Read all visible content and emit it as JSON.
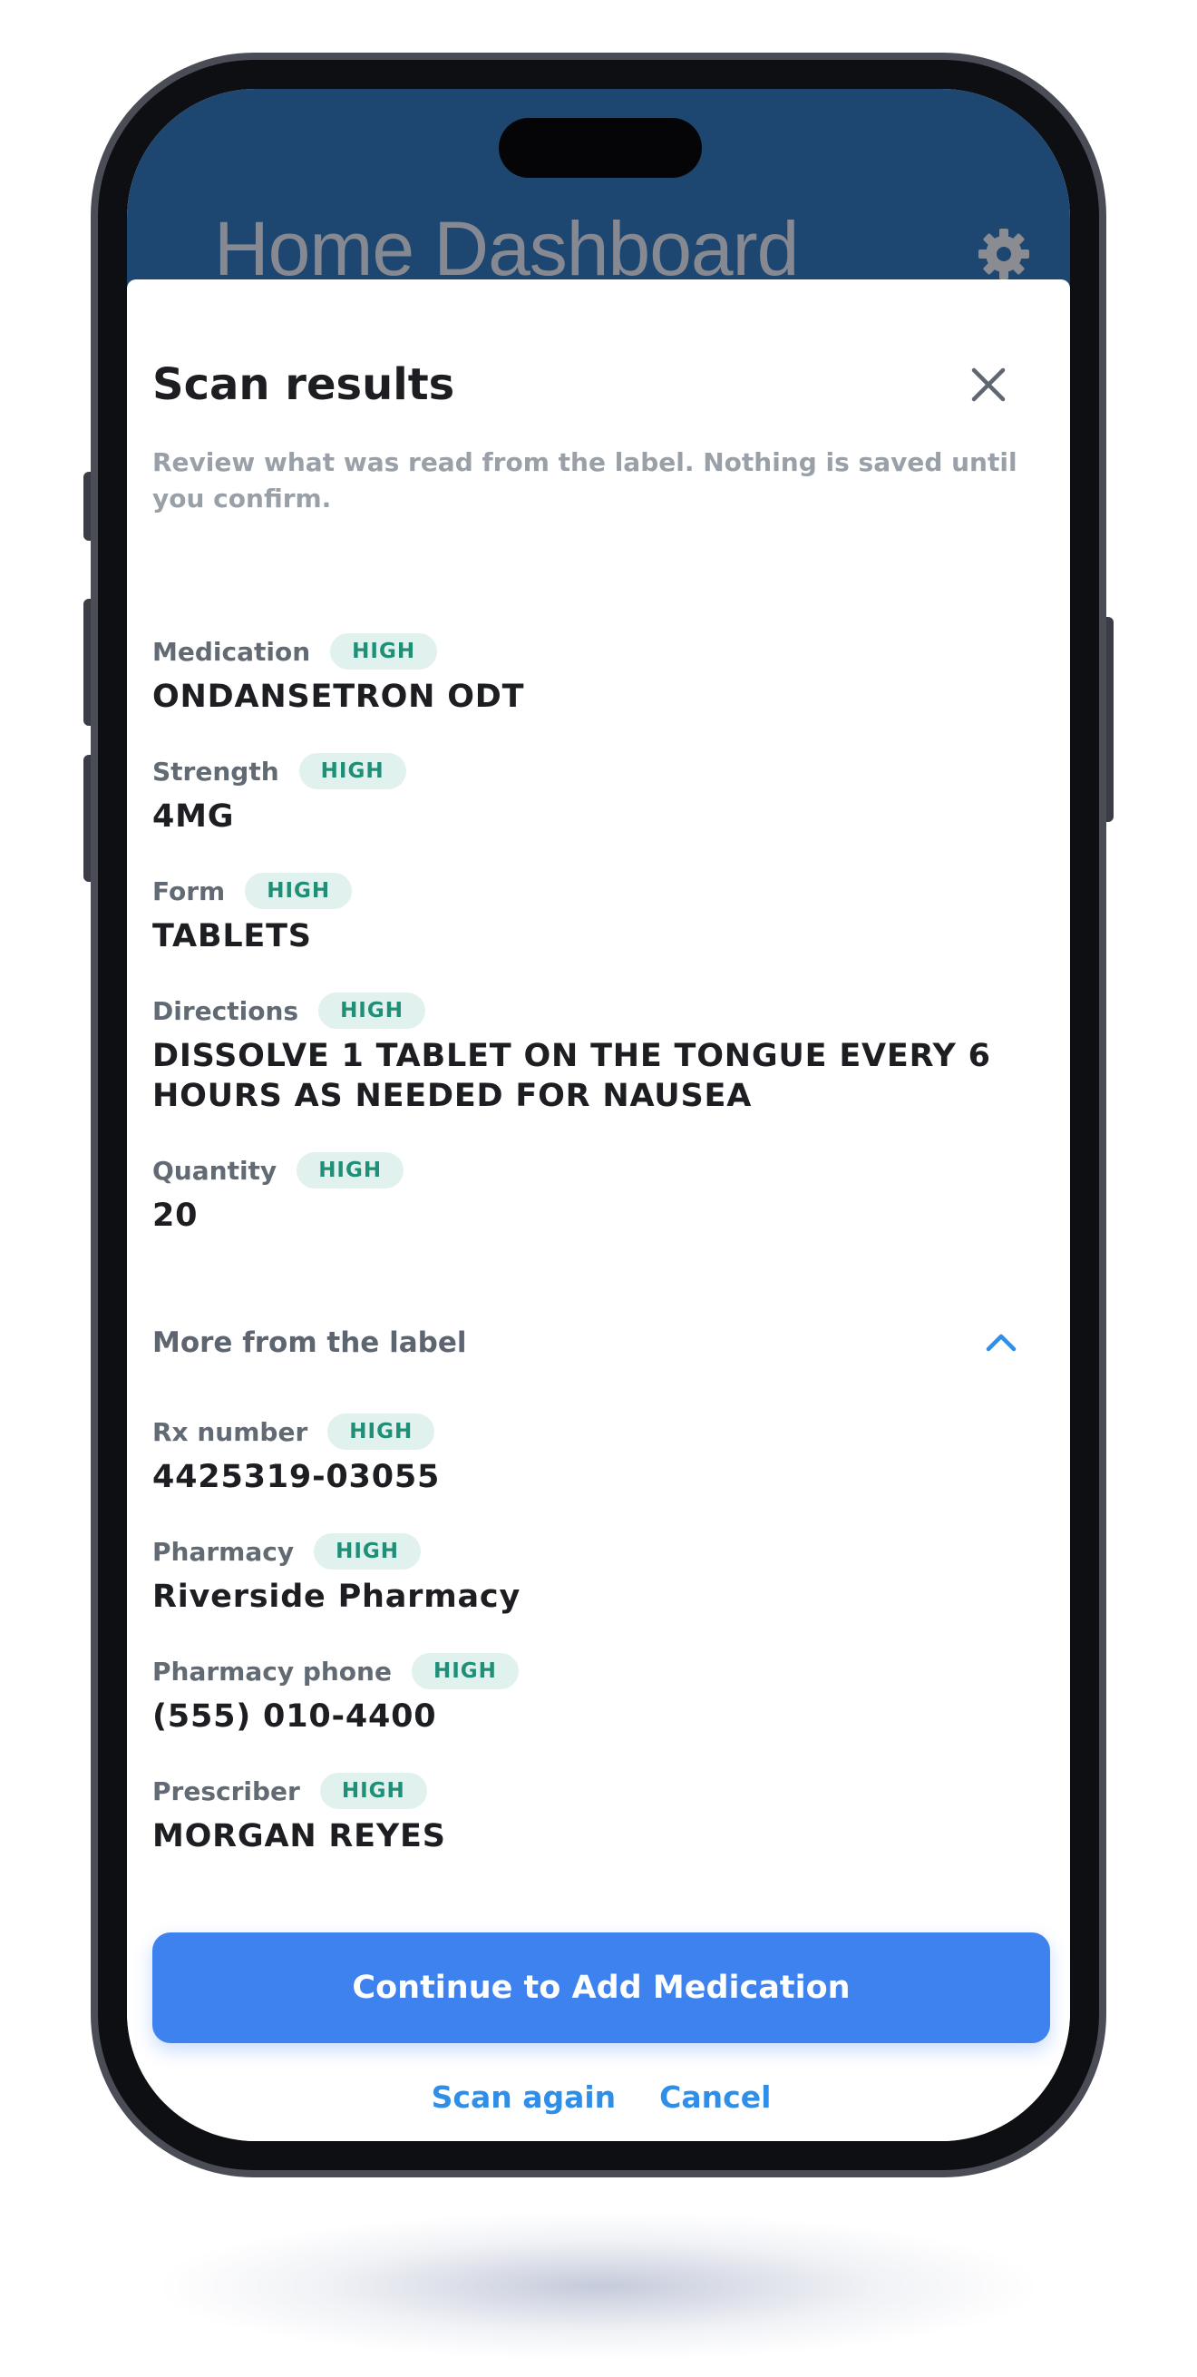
{
  "header": {
    "title": "Home Dashboard",
    "settings_icon": "gear-icon"
  },
  "sheet": {
    "title": "Scan results",
    "close_icon": "close-icon",
    "subtitle": "Review what was read from the label. Nothing is saved until you confirm."
  },
  "fields": [
    {
      "label": "Medication",
      "confidence": "HIGH",
      "value": "ONDANSETRON ODT"
    },
    {
      "label": "Strength",
      "confidence": "HIGH",
      "value": "4MG"
    },
    {
      "label": "Form",
      "confidence": "HIGH",
      "value": "TABLETS"
    },
    {
      "label": "Directions",
      "confidence": "HIGH",
      "value": "DISSOLVE 1 TABLET ON THE TONGUE EVERY 6 HOURS AS NEEDED FOR NAUSEA"
    },
    {
      "label": "Quantity",
      "confidence": "HIGH",
      "value": "20"
    }
  ],
  "more_section": {
    "title": "More from the label",
    "expanded_icon": "chevron-up-icon",
    "fields": [
      {
        "label": "Rx number",
        "confidence": "HIGH",
        "value": "4425319-03055"
      },
      {
        "label": "Pharmacy",
        "confidence": "HIGH",
        "value": "Riverside Pharmacy"
      },
      {
        "label": "Pharmacy phone",
        "confidence": "HIGH",
        "value": "(555) 010-4400"
      },
      {
        "label": "Prescriber",
        "confidence": "HIGH",
        "value": "MORGAN REYES"
      }
    ]
  },
  "actions": {
    "primary": "Continue to Add Medication",
    "scan_again": "Scan again",
    "cancel": "Cancel"
  },
  "colors": {
    "header_bg": "#1d4670",
    "primary": "#3e82f0",
    "link": "#2f8fe8",
    "badge_bg": "#e1f1ee",
    "badge_text": "#1f8f78"
  }
}
